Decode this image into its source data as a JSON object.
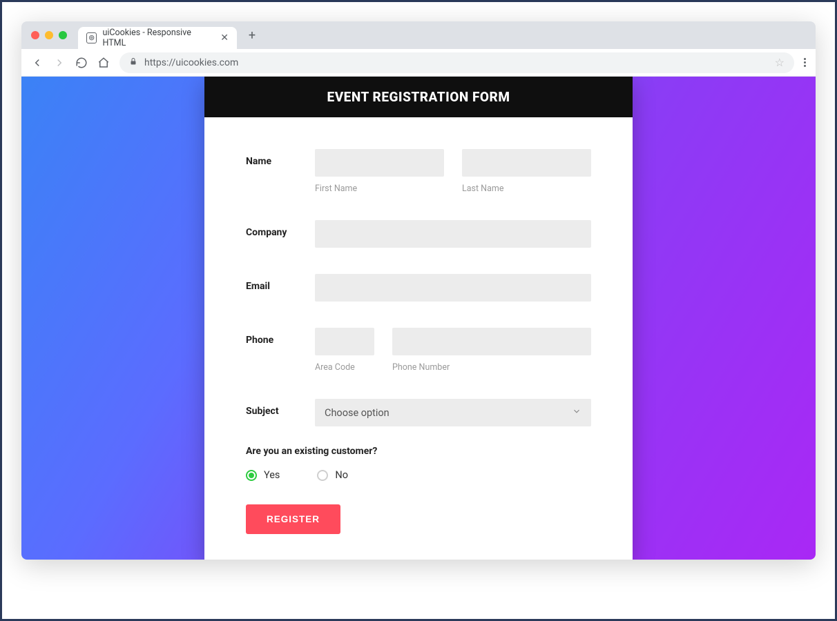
{
  "browser": {
    "tab_title": "uiCookies - Responsive HTML",
    "url": "https://uicookies.com"
  },
  "form": {
    "title": "EVENT REGISTRATION FORM",
    "name": {
      "label": "Name",
      "first_sub": "First Name",
      "last_sub": "Last Name"
    },
    "company": {
      "label": "Company"
    },
    "email": {
      "label": "Email"
    },
    "phone": {
      "label": "Phone",
      "area_sub": "Area Code",
      "number_sub": "Phone Number"
    },
    "subject": {
      "label": "Subject",
      "placeholder": "Choose option"
    },
    "question": "Are you an existing customer?",
    "radio_yes": "Yes",
    "radio_no": "No",
    "submit": "REGISTER"
  }
}
